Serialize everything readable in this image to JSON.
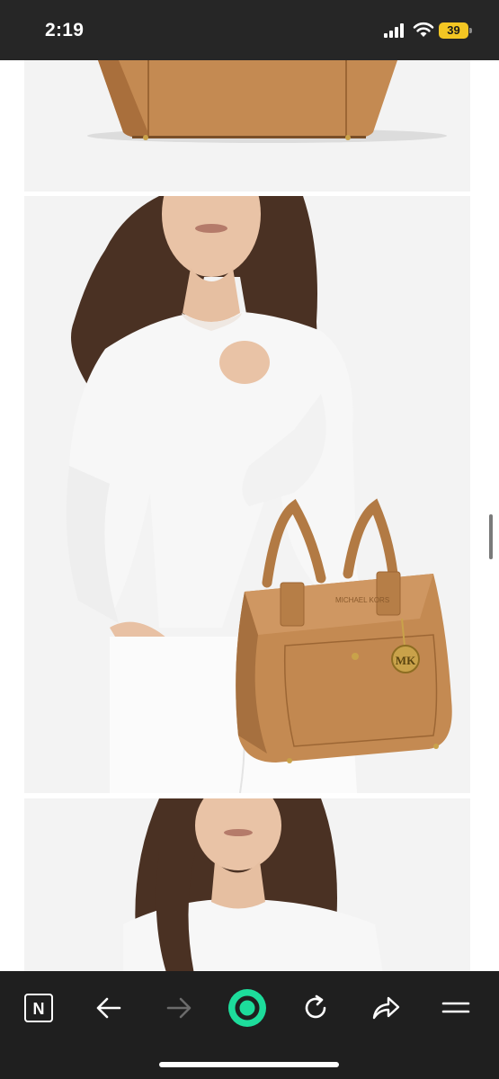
{
  "status_bar": {
    "time": "2:19",
    "battery_level": "39",
    "icons": [
      "signal-icon",
      "wifi-icon",
      "battery-icon"
    ]
  },
  "gallery": {
    "images": [
      {
        "subject": "handbag-bottom-view",
        "description_role": "product image"
      },
      {
        "subject": "model-with-tote-bag",
        "description_role": "product image"
      },
      {
        "subject": "model-portrait",
        "description_role": "product image"
      }
    ],
    "product_color": "#C48A52"
  },
  "bag_logo": "MK",
  "bag_brand_text": "MICHAEL KORS",
  "toolbar": {
    "buttons": [
      {
        "name": "n-tab-icon",
        "label": "N"
      },
      {
        "name": "back-icon"
      },
      {
        "name": "forward-icon"
      },
      {
        "name": "home-icon"
      },
      {
        "name": "reload-icon"
      },
      {
        "name": "share-icon"
      },
      {
        "name": "menu-icon"
      }
    ],
    "accent_color": "#1DDC9B"
  }
}
